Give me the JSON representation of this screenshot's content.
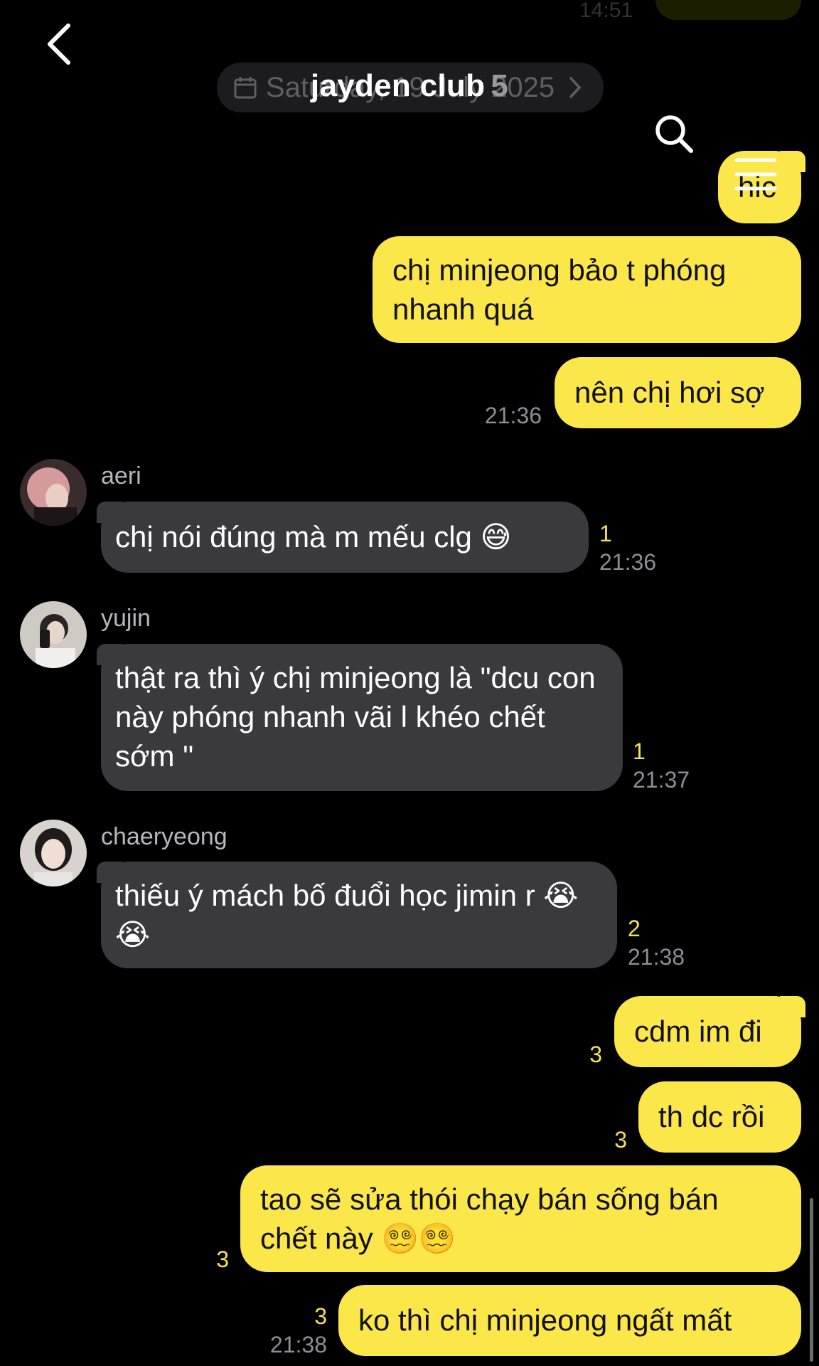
{
  "header": {
    "ghost_time": "14:51",
    "title": "jayden club",
    "member_count": "5",
    "date_label": "Saturday, 19 July 2025"
  },
  "icons": {
    "back": "chevron-left-icon",
    "search": "search-icon",
    "menu": "hamburger-menu-icon",
    "calendar": "calendar-icon",
    "date_chevron": "chevron-right-icon"
  },
  "colors": {
    "background": "#000000",
    "outgoing_bubble": "#fbe74a",
    "incoming_bubble": "#3a3a3c",
    "unread_count": "#f4e34a",
    "timestamp": "#8e8e93"
  },
  "messages": [
    {
      "direction": "out",
      "text": "hic"
    },
    {
      "direction": "out",
      "text": "chị minjeong bảo t phóng nhanh quá"
    },
    {
      "direction": "out",
      "text": "nên chị hơi sợ",
      "time": "21:36"
    },
    {
      "direction": "in",
      "sender": "aeri",
      "text": "chị nói đúng mà m mếu clg 😅",
      "unread": "1",
      "time": "21:36"
    },
    {
      "direction": "in",
      "sender": "yujin",
      "text": "thật ra thì ý chị minjeong là \"dcu con này phóng nhanh vãi l khéo chết sớm \"",
      "unread": "1",
      "time": "21:37"
    },
    {
      "direction": "in",
      "sender": "chaeryeong",
      "text": "thiếu ý mách bố đuổi học jimin r 😭😭",
      "unread": "2",
      "time": "21:38"
    },
    {
      "direction": "out",
      "text": "cdm im đi",
      "unread": "3"
    },
    {
      "direction": "out",
      "text": "th dc rồi",
      "unread": "3"
    },
    {
      "direction": "out",
      "text": "tao sẽ sửa thói chạy bán sống bán chết này 😵‍💫😵‍💫",
      "unread": "3"
    },
    {
      "direction": "out",
      "text": "ko thì chị minjeong ngất mất",
      "unread": "3",
      "time": "21:38"
    }
  ]
}
